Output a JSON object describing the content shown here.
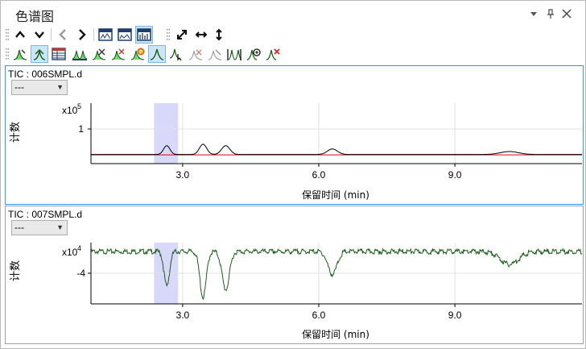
{
  "window": {
    "title": "色谱图",
    "controls": [
      "dropdown-arrow",
      "pin",
      "close"
    ]
  },
  "toolbar1": {
    "icons": [
      "chevron-up",
      "chevron-down",
      "chevron-left",
      "chevron-right",
      "spectrum-zoom-1",
      "spectrum-zoom-2",
      "spectrum-zoom-3",
      "expand-diagonal",
      "expand-horizontal",
      "expand-vertical"
    ]
  },
  "toolbar2": {
    "icons": [
      "peak-tool-1",
      "peak-tool-2",
      "table-view",
      "peak-integrate",
      "peak-tool-5",
      "peak-tool-6",
      "peak-tool-7",
      "peak-tool-8",
      "peak-tool-9",
      "peak-tool-10",
      "peak-tool-11",
      "peak-tool-12",
      "peak-tool-13",
      "peak-tool-14"
    ]
  },
  "panels": [
    {
      "label": "TIC : 006SMPL.d",
      "selector_value": "---",
      "y_axis_title": "计数",
      "multiplier": "x10",
      "exponent": "5",
      "y_tick": "1",
      "x_ticks": [
        "3.0",
        "6.0",
        "9.0"
      ],
      "x_axis_title": "保留时间 (min)"
    },
    {
      "label": "TIC : 007SMPL.d",
      "selector_value": "---",
      "y_axis_title": "计数",
      "multiplier": "x10",
      "exponent": "4",
      "y_tick": "-4",
      "x_ticks": [
        "3.0",
        "6.0",
        "9.0"
      ],
      "x_axis_title": "保留时间 (min)"
    }
  ],
  "chart_data": [
    {
      "type": "line",
      "x_unit": "min",
      "xlim": [
        0.98,
        11.8
      ],
      "ylim": [
        -0.25,
        1.4
      ],
      "y_scale_exponent": 5,
      "highlight_range": [
        2.37,
        2.9
      ],
      "line_color": "#000000",
      "baseline_color": "#e00000",
      "peaks": [
        {
          "x": 2.65,
          "height": 0.24,
          "width": 0.07
        },
        {
          "x": 3.45,
          "height": 0.28,
          "width": 0.08
        },
        {
          "x": 3.95,
          "height": 0.24,
          "width": 0.09
        },
        {
          "x": 6.3,
          "height": 0.15,
          "width": 0.11
        },
        {
          "x": 10.2,
          "height": 0.08,
          "width": 0.2
        }
      ]
    },
    {
      "type": "line",
      "x_unit": "min",
      "xlim": [
        0.98,
        11.8
      ],
      "ylim": [
        -10.5,
        1.5
      ],
      "y_scale_exponent": 4,
      "baseline": 0,
      "highlight_range": [
        2.37,
        2.9
      ],
      "line_color": "#1f5c1f",
      "peaks": [
        {
          "x": 2.65,
          "depth": -6.8,
          "width": 0.06
        },
        {
          "x": 3.45,
          "depth": -9.0,
          "width": 0.07
        },
        {
          "x": 3.95,
          "depth": -7.5,
          "width": 0.08
        },
        {
          "x": 6.3,
          "depth": -4.5,
          "width": 0.1
        },
        {
          "x": 10.2,
          "depth": -2.5,
          "width": 0.2
        }
      ]
    }
  ]
}
